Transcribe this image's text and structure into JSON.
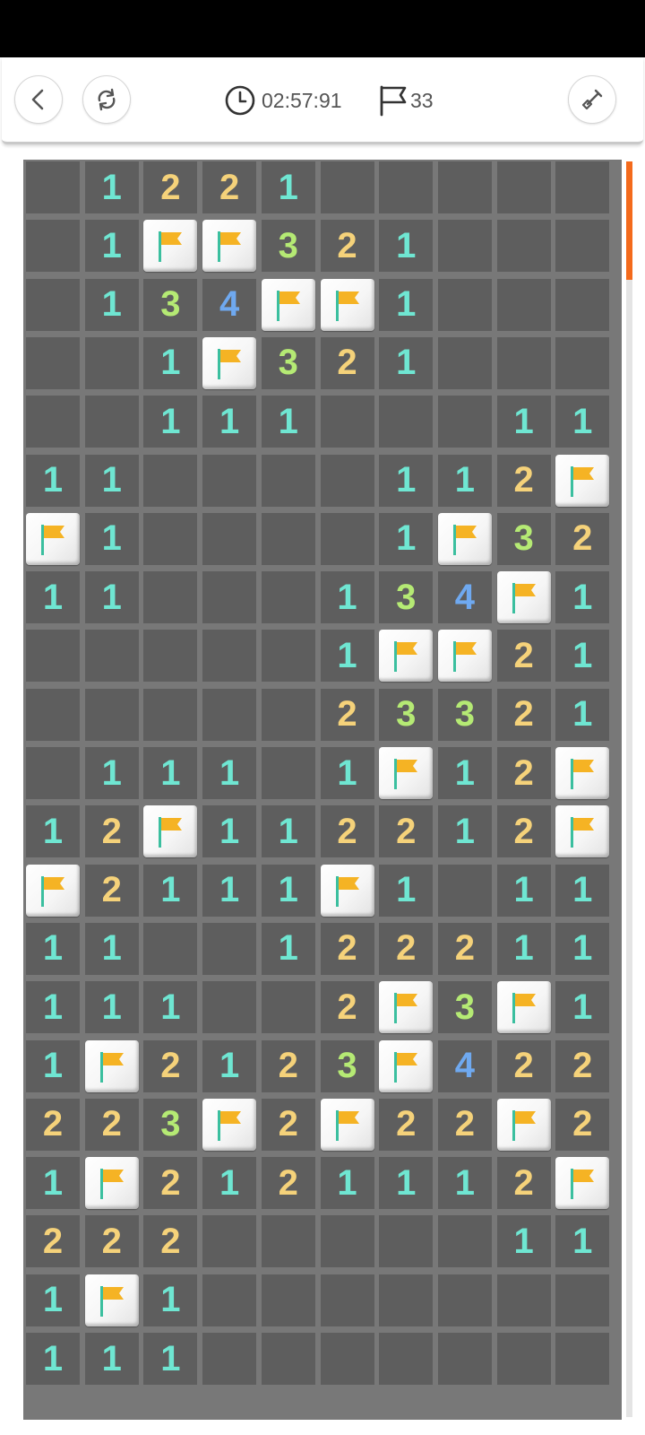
{
  "header": {
    "timer": "02:57:91",
    "flags_remaining": "33",
    "back_icon": "chevron-left-icon",
    "restart_icon": "refresh-icon",
    "timer_icon": "clock-icon",
    "flag_icon": "flag-outline-icon",
    "tool_icon": "shovel-icon"
  },
  "colors": {
    "cell": "#5e5e5e",
    "grid": "#787878",
    "num_1": "#6fe6d2",
    "num_2": "#f5d27a",
    "num_3": "#b5ea74",
    "num_4": "#6fa9f0",
    "flag": "#f5b324",
    "scroll_thumb": "#f46a1c"
  },
  "scroll": {
    "position": 0
  },
  "board": {
    "columns": 10,
    "rows": [
      [
        "",
        "1",
        "2",
        "2",
        "1",
        "",
        "",
        "",
        "",
        ""
      ],
      [
        "",
        "1",
        "F",
        "F",
        "3",
        "2",
        "1",
        "",
        "",
        ""
      ],
      [
        "",
        "1",
        "3",
        "4",
        "F",
        "F",
        "1",
        "",
        "",
        ""
      ],
      [
        "",
        "",
        "1",
        "F",
        "3",
        "2",
        "1",
        "",
        "",
        ""
      ],
      [
        "",
        "",
        "1",
        "1",
        "1",
        "",
        "",
        "",
        "1",
        "1"
      ],
      [
        "1",
        "1",
        "",
        "",
        "",
        "",
        "1",
        "1",
        "2",
        "F"
      ],
      [
        "F",
        "1",
        "",
        "",
        "",
        "",
        "1",
        "F",
        "3",
        "2"
      ],
      [
        "1",
        "1",
        "",
        "",
        "",
        "1",
        "3",
        "4",
        "F",
        "1"
      ],
      [
        "",
        "",
        "",
        "",
        "",
        "1",
        "F",
        "F",
        "2",
        "1"
      ],
      [
        "",
        "",
        "",
        "",
        "",
        "2",
        "3",
        "3",
        "2",
        "1"
      ],
      [
        "",
        "1",
        "1",
        "1",
        "",
        "1",
        "F",
        "1",
        "2",
        "F"
      ],
      [
        "1",
        "2",
        "F",
        "1",
        "1",
        "2",
        "2",
        "1",
        "2",
        "F"
      ],
      [
        "F",
        "2",
        "1",
        "1",
        "1",
        "F",
        "1",
        "",
        "1",
        "1"
      ],
      [
        "1",
        "1",
        "",
        "",
        "1",
        "2",
        "2",
        "2",
        "1",
        "1"
      ],
      [
        "1",
        "1",
        "1",
        "",
        "",
        "2",
        "F",
        "3",
        "F",
        "1"
      ],
      [
        "1",
        "F",
        "2",
        "1",
        "2",
        "3",
        "F",
        "4",
        "2",
        "2"
      ],
      [
        "2",
        "2",
        "3",
        "F",
        "2",
        "F",
        "2",
        "2",
        "F",
        "2"
      ],
      [
        "1",
        "F",
        "2",
        "1",
        "2",
        "1",
        "1",
        "1",
        "2",
        "F"
      ],
      [
        "2",
        "2",
        "2",
        "",
        "",
        "",
        "",
        "",
        "1",
        "1"
      ],
      [
        "1",
        "F",
        "1",
        "",
        "",
        "",
        "",
        "",
        "",
        ""
      ],
      [
        "1",
        "1",
        "1",
        "",
        "",
        "",
        "",
        "",
        "",
        ""
      ]
    ]
  }
}
